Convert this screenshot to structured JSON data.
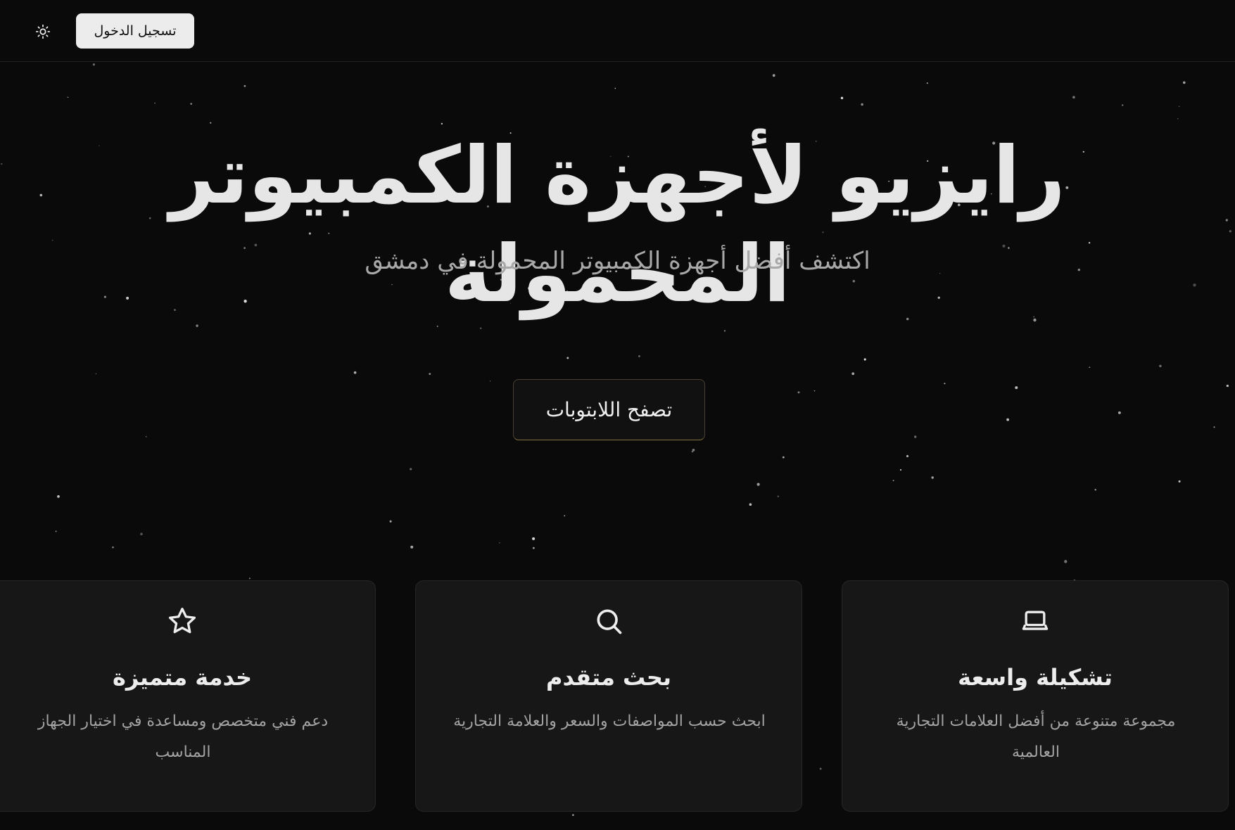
{
  "header": {
    "login_label": "تسجيل الدخول",
    "theme_icon": "sun-icon"
  },
  "hero": {
    "title": "رايزيو لأجهزة الكمبيوتر المحمولة",
    "subtitle": "اكتشف أفضل أجهزة الكمبيوتر المحمولة في دمشق",
    "browse_label": "تصفح اللابتوبات"
  },
  "features": [
    {
      "icon": "laptop-icon",
      "title": "تشكيلة واسعة",
      "description": "مجموعة متنوعة من أفضل العلامات التجارية العالمية"
    },
    {
      "icon": "search-icon",
      "title": "بحث متقدم",
      "description": "ابحث حسب المواصفات والسعر والعلامة التجارية"
    },
    {
      "icon": "star-icon",
      "title": "خدمة متميزة",
      "description": "دعم فني متخصص ومساعدة في اختيار الجهاز المناسب"
    }
  ],
  "colors": {
    "background": "#0a0a0a",
    "card": "#171717",
    "accent_border": "#8a7440",
    "text": "#ededed",
    "muted": "#a3a3a3"
  }
}
